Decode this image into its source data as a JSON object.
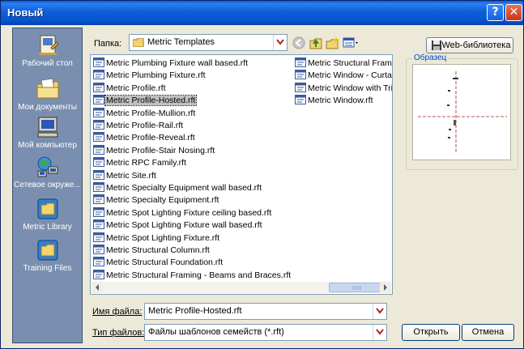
{
  "window": {
    "title": "Новый",
    "help_label": "?",
    "close_label": "✕"
  },
  "places": [
    {
      "label": "Рабочий стол",
      "icon": "desktop-icon"
    },
    {
      "label": "Мои документы",
      "icon": "my-documents-icon"
    },
    {
      "label": "Мой компьютер",
      "icon": "my-computer-icon"
    },
    {
      "label": "Сетевое окруже...",
      "icon": "network-icon"
    },
    {
      "label": "Metric Library",
      "icon": "folder-shortcut-icon"
    },
    {
      "label": "Training Files",
      "icon": "folder-shortcut-icon"
    }
  ],
  "folder": {
    "label": "Папка:",
    "value": "Metric Templates"
  },
  "web_button_label": "Web-библиотека",
  "files_col1": [
    "Metric Plumbing Fixture wall based.rft",
    "Metric Plumbing Fixture.rft",
    "Metric Profile.rft",
    "Metric Profile-Hosted.rft",
    "Metric Profile-Mullion.rft",
    "Metric Profile-Rail.rft",
    "Metric Profile-Reveal.rft",
    "Metric Profile-Stair Nosing.rft",
    "Metric RPC Family.rft",
    "Metric Site.rft",
    "Metric Specialty Equipment wall based.rft",
    "Metric Specialty Equipment.rft",
    "Metric Spot Lighting Fixture ceiling based.rft",
    "Metric Spot Lighting Fixture wall based.rft",
    "Metric Spot Lighting Fixture.rft",
    "Metric Structural Column.rft",
    "Metric Structural Foundation.rft",
    "Metric Structural Framing - Beams and Braces.rft"
  ],
  "files_col2": [
    "Metric Structural Frami",
    "Metric Window - Curtai",
    "Metric Window with Tri",
    "Metric Window.rft"
  ],
  "selected_file": "Metric Profile-Hosted.rft",
  "preview": {
    "label": "Образец"
  },
  "filename": {
    "label": "Имя файла:",
    "value": "Metric Profile-Hosted.rft"
  },
  "filetype": {
    "label": "Тип файлов:",
    "value": "Файлы шаблонов семейств (*.rft)"
  },
  "buttons": {
    "open": "Открыть",
    "cancel": "Отмена"
  },
  "colors": {
    "titlebar": "#0a5bd8",
    "places_bg": "#7a8fb0",
    "dialog_bg": "#ece9d8",
    "selection": "#c0c0c0",
    "combo_arrow": "#b42121"
  }
}
